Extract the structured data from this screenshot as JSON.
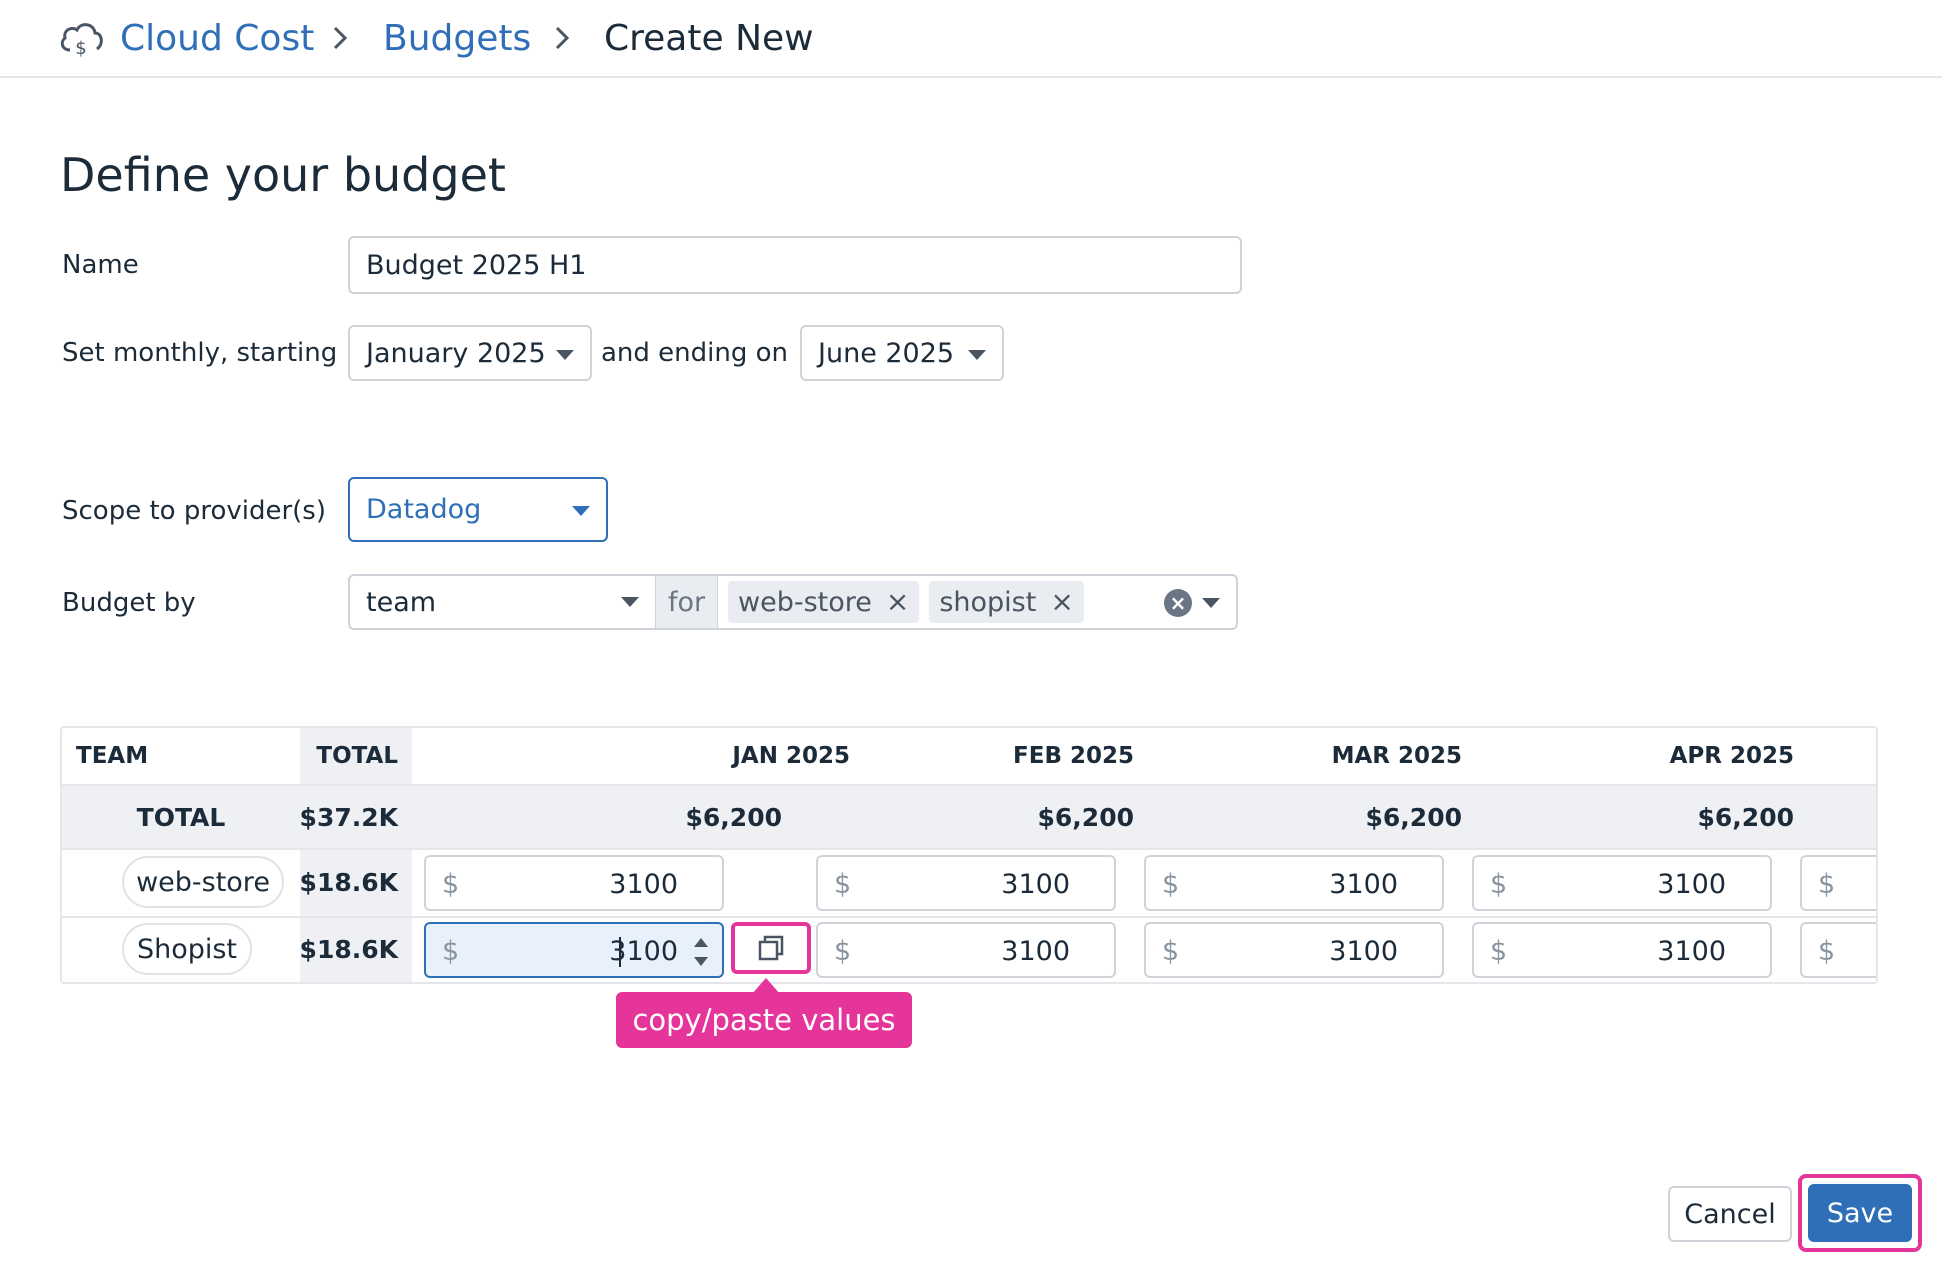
{
  "breadcrumb": {
    "items": [
      "Cloud Cost",
      "Budgets",
      "Create New"
    ],
    "icon": "cloud-dollar-icon"
  },
  "page": {
    "title": "Define your budget"
  },
  "form": {
    "name_label": "Name",
    "name_value": "Budget 2025 H1",
    "monthly_label": "Set monthly, starting",
    "start_month": "January 2025",
    "ending_label": "and ending on",
    "end_month": "June 2025",
    "scope_label": "Scope to provider(s)",
    "scope_value": "Datadog",
    "budget_by_label": "Budget by",
    "budget_by_value": "team",
    "for_label": "for",
    "tags": [
      "web-store",
      "shopist"
    ]
  },
  "table": {
    "headers": [
      "TEAM",
      "TOTAL",
      "JAN 2025",
      "FEB 2025",
      "MAR 2025",
      "APR 2025"
    ],
    "total_row": {
      "label": "TOTAL",
      "total": "$37.2K",
      "months": [
        "$6,200",
        "$6,200",
        "$6,200",
        "$6,200"
      ]
    },
    "rows": [
      {
        "team": "web-store",
        "total": "$18.6K",
        "currency": "$",
        "values": [
          "3100",
          "3100",
          "3100",
          "3100"
        ],
        "next_currency": "$"
      },
      {
        "team": "Shopist",
        "total": "$18.6K",
        "currency": "$",
        "values": [
          "3100",
          "3100",
          "3100",
          "3100"
        ],
        "next_currency": "$"
      }
    ]
  },
  "annotation": {
    "tooltip": "copy/paste values",
    "color": "#e5359a"
  },
  "actions": {
    "cancel": "Cancel",
    "save": "Save"
  },
  "colors": {
    "accent": "#2f6fb8",
    "highlight": "#e5359a",
    "text": "#1c2b39"
  }
}
